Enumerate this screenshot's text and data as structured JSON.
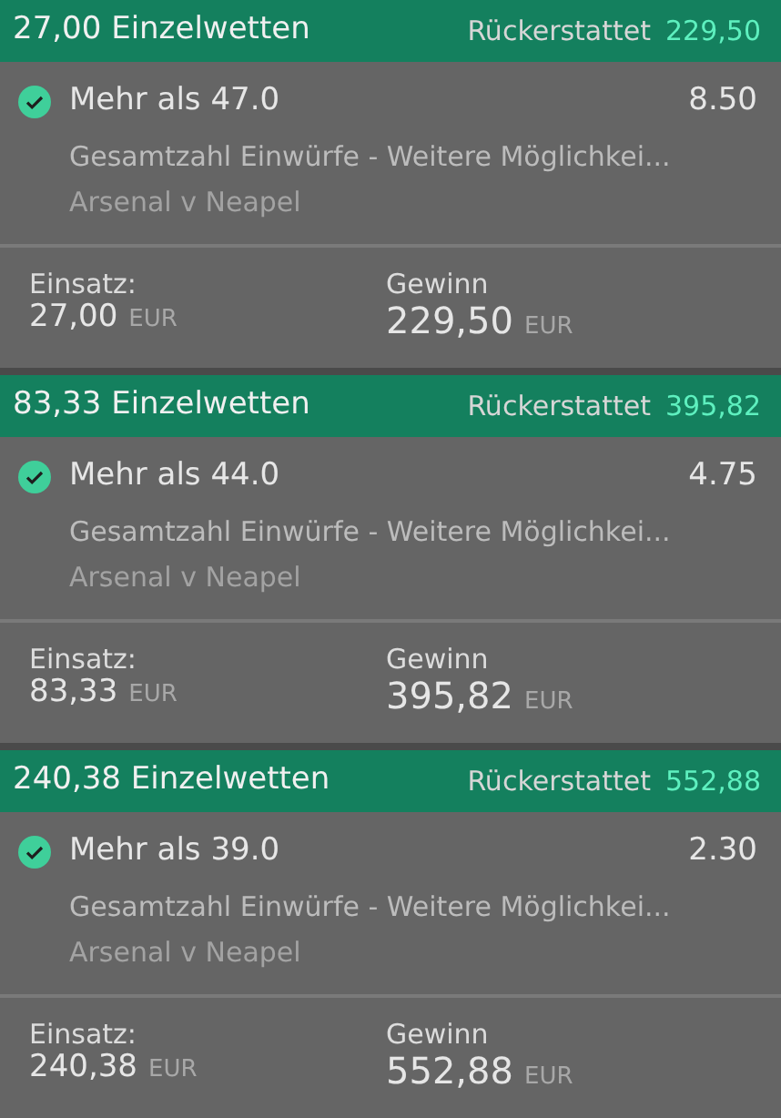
{
  "bets": [
    {
      "title": "27,00 Einzelwetten",
      "returned_label": "Rückerstattet",
      "returned_amount": "229,50",
      "won": true,
      "selection": "Mehr als 47.0",
      "odds": "8.50",
      "market": "Gesamtzahl Einwürfe - Weitere Möglichkei...",
      "event": "Arsenal v Neapel",
      "stake_label": "Einsatz:",
      "stake": "27,00",
      "stake_currency": "EUR",
      "win_label": "Gewinn",
      "win": "229,50",
      "win_currency": "EUR"
    },
    {
      "title": "83,33 Einzelwetten",
      "returned_label": "Rückerstattet",
      "returned_amount": "395,82",
      "won": true,
      "selection": "Mehr als 44.0",
      "odds": "4.75",
      "market": "Gesamtzahl Einwürfe - Weitere Möglichkei...",
      "event": "Arsenal v Neapel",
      "stake_label": "Einsatz:",
      "stake": "83,33",
      "stake_currency": "EUR",
      "win_label": "Gewinn",
      "win": "395,82",
      "win_currency": "EUR"
    },
    {
      "title": "240,38 Einzelwetten",
      "returned_label": "Rückerstattet",
      "returned_amount": "552,88",
      "won": true,
      "selection": "Mehr als 39.0",
      "odds": "2.30",
      "market": "Gesamtzahl Einwürfe - Weitere Möglichkei...",
      "event": "Arsenal v Neapel",
      "stake_label": "Einsatz:",
      "stake": "240,38",
      "stake_currency": "EUR",
      "win_label": "Gewinn",
      "win": "552,88",
      "win_currency": "EUR"
    }
  ]
}
